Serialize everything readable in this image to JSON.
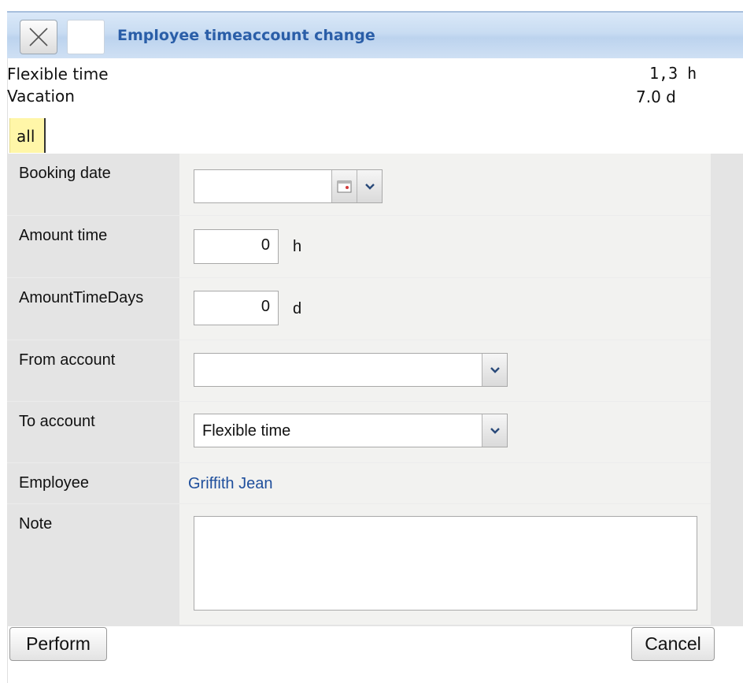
{
  "dialog": {
    "title": "Employee timeaccount change"
  },
  "balances": [
    {
      "label": "Flexible time",
      "value": "1,3 h"
    },
    {
      "label": "Vacation",
      "value": "7.0 d"
    }
  ],
  "tabs": [
    {
      "label": "all",
      "active": true
    }
  ],
  "form": {
    "booking_date": {
      "label": "Booking date",
      "value": ""
    },
    "amount_time": {
      "label": "Amount time",
      "value": "0",
      "unit": "h"
    },
    "amount_time_days": {
      "label": "AmountTimeDays",
      "value": "0",
      "unit": "d"
    },
    "from_account": {
      "label": "From account",
      "value": ""
    },
    "to_account": {
      "label": "To account",
      "value": "Flexible time"
    },
    "employee": {
      "label": "Employee",
      "value": "Griffith Jean"
    },
    "note": {
      "label": "Note",
      "value": ""
    }
  },
  "buttons": {
    "perform": "Perform",
    "cancel": "Cancel"
  },
  "colors": {
    "title_text": "#2a5ea8",
    "title_bar": "#c8dcf2",
    "tab_active": "#fff6a8",
    "link": "#1f4f9c",
    "label_bg": "#e4e4e4",
    "field_bg": "#f2f2f0"
  },
  "icons": {
    "close": "close-icon",
    "calendar": "calendar-icon",
    "dropdown": "chevron-down-icon"
  }
}
